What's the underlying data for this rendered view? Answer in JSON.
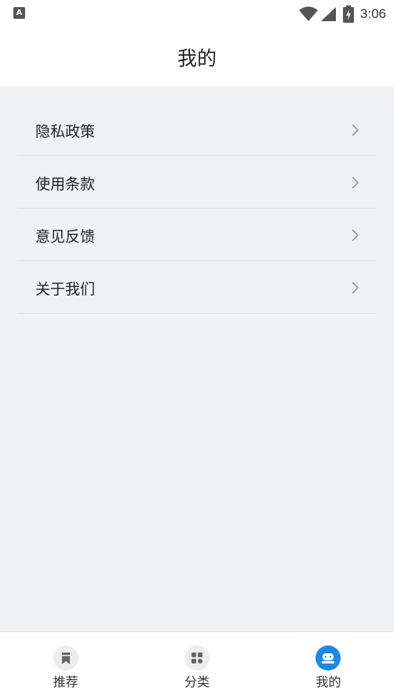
{
  "status_bar": {
    "time": "3:06",
    "app_icon": "a-badge-icon",
    "icons": [
      "wifi-icon",
      "cell-signal-icon",
      "battery-charging-icon"
    ]
  },
  "header": {
    "title": "我的"
  },
  "menu": {
    "items": [
      {
        "label": "隐私政策",
        "icon": "chevron-right-icon"
      },
      {
        "label": "使用条款",
        "icon": "chevron-right-icon"
      },
      {
        "label": "意见反馈",
        "icon": "chevron-right-icon"
      },
      {
        "label": "关于我们",
        "icon": "chevron-right-icon"
      }
    ]
  },
  "bottom_nav": {
    "items": [
      {
        "label": "推荐",
        "icon": "bookmark-icon",
        "active": false
      },
      {
        "label": "分类",
        "icon": "grid-icon",
        "active": false
      },
      {
        "label": "我的",
        "icon": "profile-icon",
        "active": true
      }
    ]
  },
  "colors": {
    "accent": "#1e88e5",
    "background": "#f1f2f4",
    "surface": "#ffffff"
  }
}
